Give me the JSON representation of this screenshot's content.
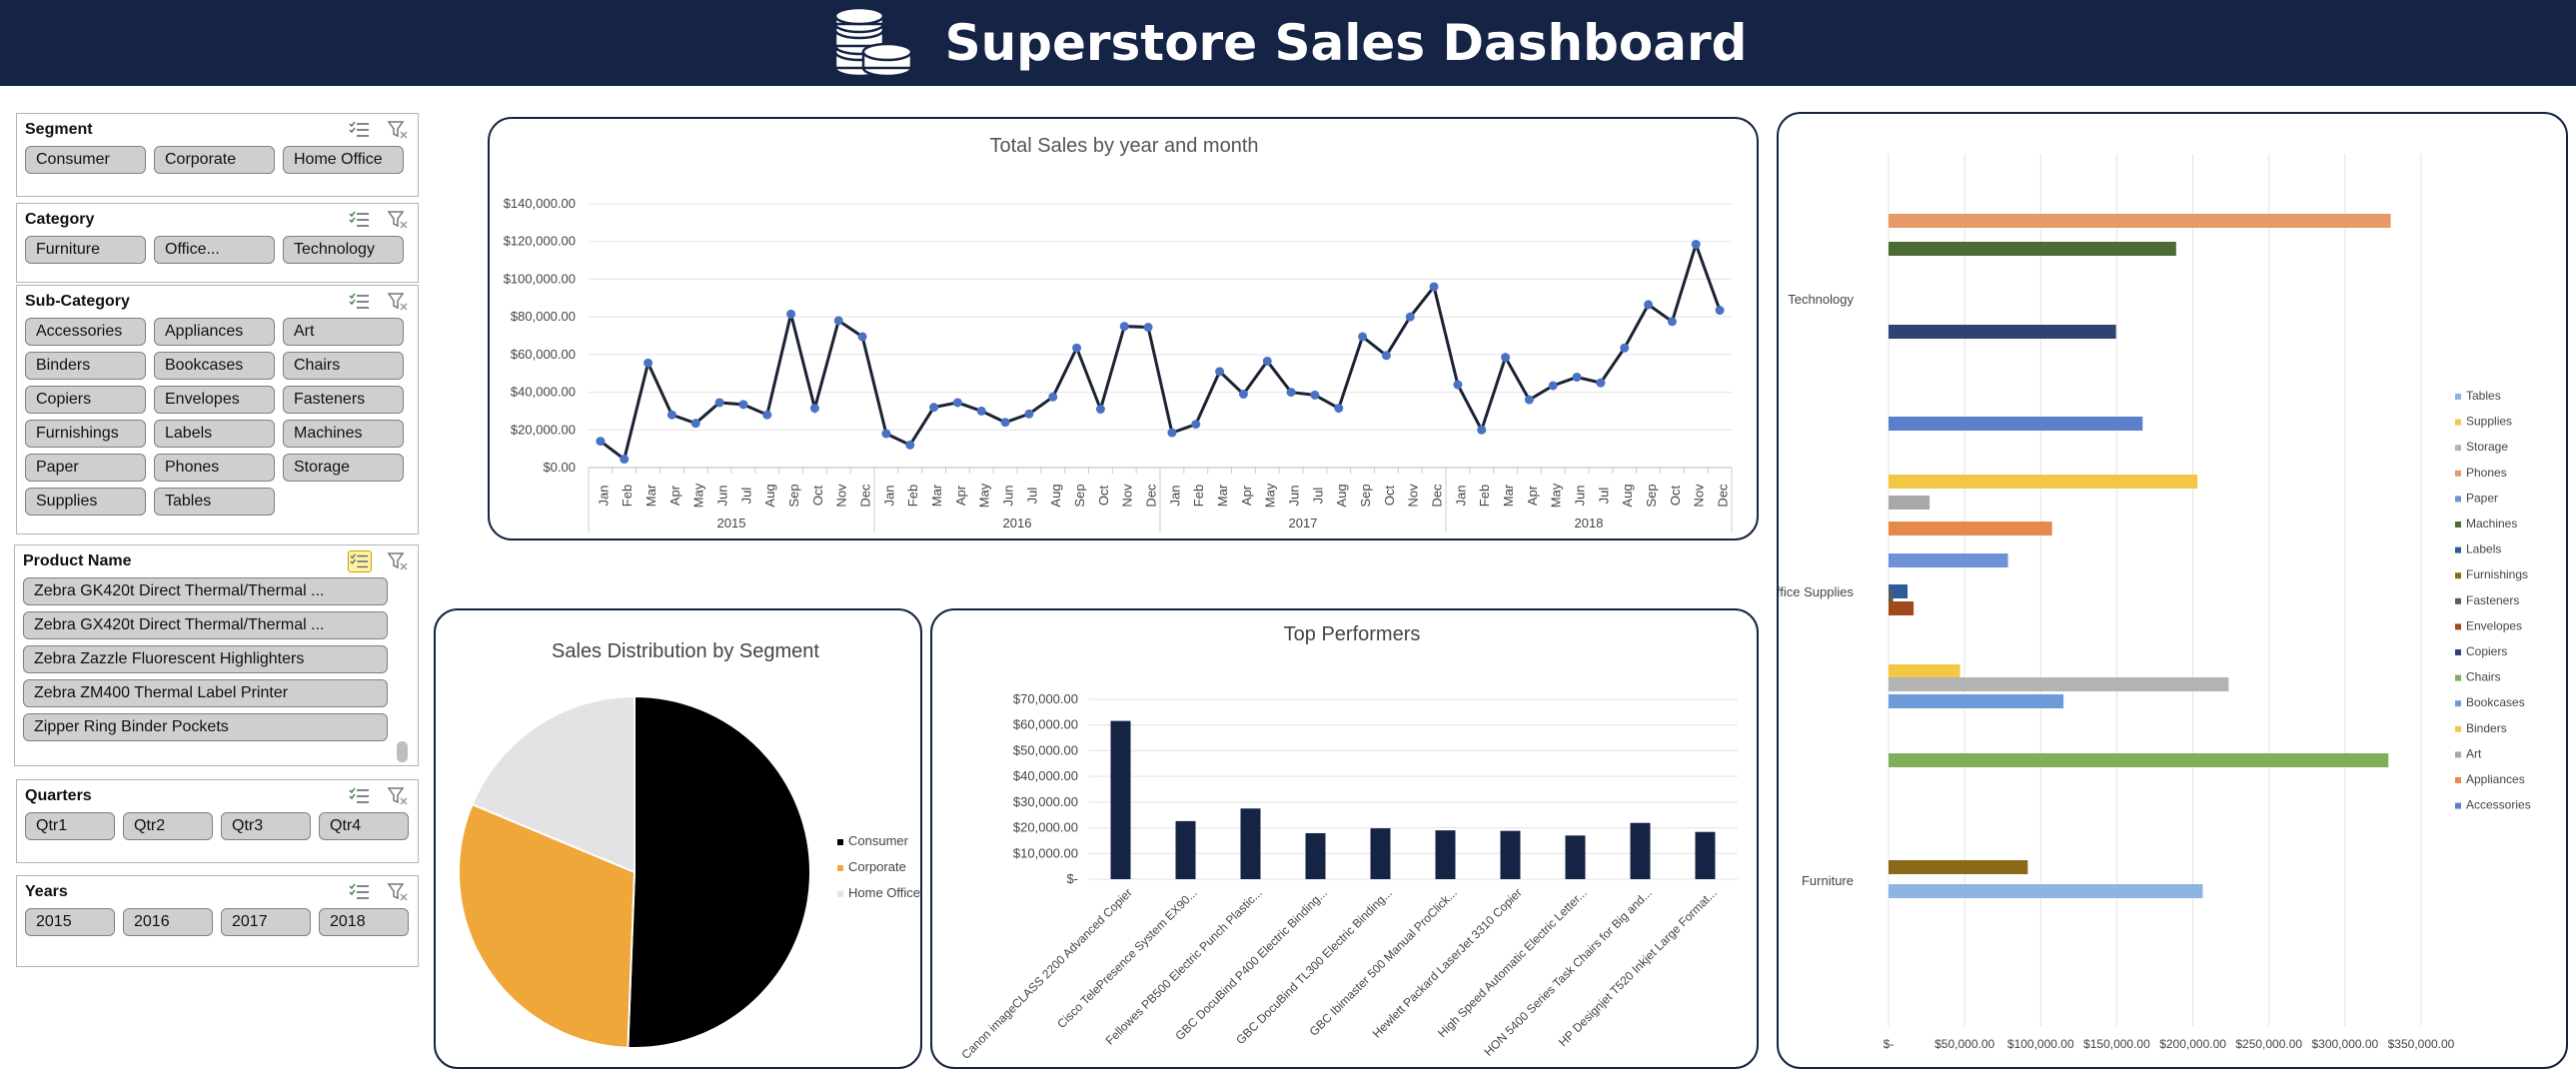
{
  "header": {
    "title": "Superstore Sales Dashboard",
    "icon": "coins-icon"
  },
  "colors": {
    "navy": "#152344",
    "line": "#1b2233",
    "marker": "#4a72c4",
    "bar": "#152344",
    "consumer": "#000000",
    "corporate": "#f0a73a",
    "homeoffice": "#e3e3e3"
  },
  "slicers": {
    "segment": {
      "title": "Segment",
      "items": [
        "Consumer",
        "Corporate",
        "Home Office"
      ]
    },
    "category": {
      "title": "Category",
      "items": [
        "Furniture",
        "Office...",
        "Technology"
      ]
    },
    "subcategory": {
      "title": "Sub-Category",
      "items": [
        "Accessories",
        "Appliances",
        "Art",
        "Binders",
        "Bookcases",
        "Chairs",
        "Copiers",
        "Envelopes",
        "Fasteners",
        "Furnishings",
        "Labels",
        "Machines",
        "Paper",
        "Phones",
        "Storage",
        "Supplies",
        "Tables"
      ]
    },
    "product": {
      "title": "Product Name",
      "items": [
        "Zebra GK420t Direct Thermal/Thermal ...",
        "Zebra GX420t Direct Thermal/Thermal ...",
        "Zebra Zazzle Fluorescent Highlighters",
        "Zebra ZM400 Thermal Label Printer",
        "Zipper Ring Binder Pockets"
      ]
    },
    "quarters": {
      "title": "Quarters",
      "items": [
        "Qtr1",
        "Qtr2",
        "Qtr3",
        "Qtr4"
      ]
    },
    "years": {
      "title": "Years",
      "items": [
        "2015",
        "2016",
        "2017",
        "2018"
      ]
    }
  },
  "chart_data": [
    {
      "type": "line",
      "title": "Total Sales by year and month",
      "months": [
        "Jan",
        "Feb",
        "Mar",
        "Apr",
        "May",
        "Jun",
        "Jul",
        "Aug",
        "Sep",
        "Oct",
        "Nov",
        "Dec"
      ],
      "years": [
        "2015",
        "2016",
        "2017",
        "2018"
      ],
      "yticks": [
        "$0.00",
        "$20,000.00",
        "$40,000.00",
        "$60,000.00",
        "$80,000.00",
        "$100,000.00",
        "$120,000.00",
        "$140,000.00"
      ],
      "ylim": [
        0,
        140000
      ],
      "values": [
        14000,
        4500,
        55500,
        28000,
        23500,
        34500,
        33500,
        28000,
        81500,
        31500,
        78000,
        69500,
        18000,
        12000,
        32000,
        34500,
        30000,
        24000,
        28500,
        37500,
        63500,
        31000,
        75000,
        74500,
        18500,
        23000,
        51000,
        39000,
        56500,
        40000,
        38500,
        31500,
        69500,
        59500,
        80000,
        96000,
        44000,
        20000,
        58500,
        36000,
        43500,
        48000,
        45000,
        63500,
        86500,
        77500,
        118500,
        83500
      ]
    },
    {
      "type": "pie",
      "title": "Sales Distribution by Segment",
      "labels": [
        "Consumer",
        "Corporate",
        "Home Office"
      ],
      "values": [
        50.6,
        30.7,
        18.7
      ]
    },
    {
      "type": "bar",
      "title": "Top Performers",
      "categories": [
        "Canon imageCLASS 2200 Advanced Copier",
        "Cisco TelePresence System EX90...",
        "Fellowes PB500 Electric Punch Plastic...",
        "GBC DocuBind P400 Electric Binding...",
        "GBC DocuBind TL300 Electric Binding...",
        "GBC Ibimaster 500 Manual ProClick...",
        "Hewlett Packard LaserJet 3310 Copier",
        "High Speed Automatic Electric Letter...",
        "HON 5400 Series Task Chairs for Big and...",
        "HP Designjet T520 Inkjet Large Format..."
      ],
      "values": [
        61600,
        22600,
        27500,
        17900,
        19800,
        19000,
        18800,
        17000,
        21900,
        18400
      ],
      "yticks": [
        "$-",
        "$10,000.00",
        "$20,000.00",
        "$30,000.00",
        "$40,000.00",
        "$50,000.00",
        "$60,000.00",
        "$70,000.00"
      ],
      "ylim": [
        0,
        70000
      ]
    },
    {
      "type": "bar",
      "orientation": "horizontal",
      "groups": [
        "Technology",
        "Office Supplies",
        "Furniture"
      ],
      "xticks": [
        "$-",
        "$50,000.00",
        "$100,000.00",
        "$150,000.00",
        "$200,000.00",
        "$250,000.00",
        "$300,000.00",
        "$350,000.00"
      ],
      "xlim": [
        0,
        350000
      ],
      "series": [
        {
          "name": "Phones",
          "category": "Technology",
          "value": 330000,
          "color": "#e59a68"
        },
        {
          "name": "Machines",
          "category": "Technology",
          "value": 189000,
          "color": "#4f6b34"
        },
        {
          "name": "Copiers",
          "category": "Technology",
          "value": 149500,
          "color": "#2d4472"
        },
        {
          "name": "Accessories",
          "category": "Technology",
          "value": 167000,
          "color": "#5b7fcb"
        },
        {
          "name": "Binders",
          "category": "Office Supplies",
          "value": 203000,
          "color": "#f2c744"
        },
        {
          "name": "Art",
          "category": "Office Supplies",
          "value": 27000,
          "color": "#a8a8a8"
        },
        {
          "name": "Appliances",
          "category": "Office Supplies",
          "value": 107500,
          "color": "#e58a4a"
        },
        {
          "name": "Paper",
          "category": "Office Supplies",
          "value": 78500,
          "color": "#6f92d6"
        },
        {
          "name": "Labels",
          "category": "Office Supplies",
          "value": 12500,
          "color": "#2d5c9a"
        },
        {
          "name": "Fasteners",
          "category": "Office Supplies",
          "value": 3000,
          "color": "#5a5a5a"
        },
        {
          "name": "Envelopes",
          "category": "Office Supplies",
          "value": 16500,
          "color": "#a04a1c"
        },
        {
          "name": "Supplies",
          "category": "Office Supplies",
          "value": 47000,
          "color": "#f2c744"
        },
        {
          "name": "Storage",
          "category": "Office Supplies",
          "value": 223500,
          "color": "#b3b3b3"
        },
        {
          "name": "Bookcases",
          "category": "Furniture",
          "value": 115000,
          "color": "#6f9ad9"
        },
        {
          "name": "Chairs",
          "category": "Furniture",
          "value": 328500,
          "color": "#7faf58"
        },
        {
          "name": "Furnishings",
          "category": "Furniture",
          "value": 91500,
          "color": "#8a6a18"
        },
        {
          "name": "Tables",
          "category": "Furniture",
          "value": 206500,
          "color": "#8db4e2"
        }
      ],
      "legend": [
        "Tables",
        "Supplies",
        "Storage",
        "Phones",
        "Paper",
        "Machines",
        "Labels",
        "Furnishings",
        "Fasteners",
        "Envelopes",
        "Copiers",
        "Chairs",
        "Bookcases",
        "Binders",
        "Art",
        "Appliances",
        "Accessories"
      ]
    }
  ]
}
